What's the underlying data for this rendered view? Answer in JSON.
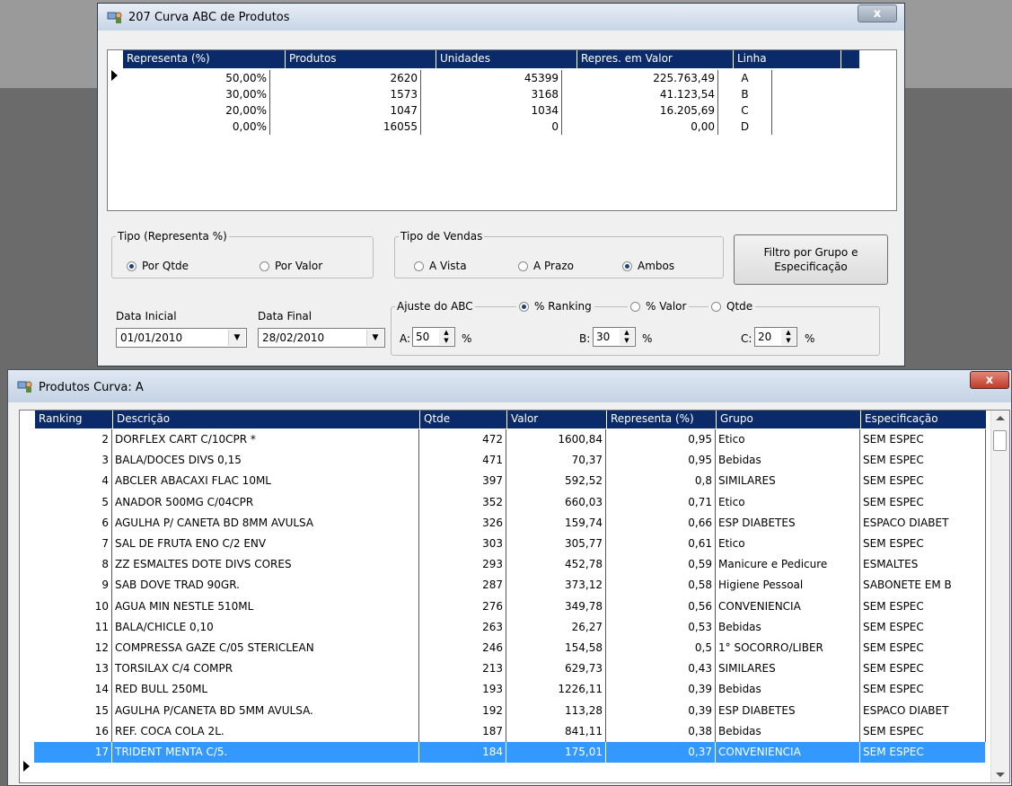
{
  "abc_window": {
    "title": "207 Curva ABC de Produtos",
    "close": "x",
    "columns": [
      "Representa (%)",
      "Produtos",
      "Unidades",
      "Repres. em Valor",
      "Linha"
    ],
    "rows": [
      [
        "50,00%",
        "2620",
        "45399",
        "225.763,49",
        "A"
      ],
      [
        "30,00%",
        "1573",
        "3168",
        "41.123,54",
        "B"
      ],
      [
        "20,00%",
        "1047",
        "1034",
        "16.205,69",
        "C"
      ],
      [
        "0,00%",
        "16055",
        "0",
        "0,00",
        "D"
      ]
    ],
    "tipo_group": {
      "legend": "Tipo (Representa %)",
      "options": [
        {
          "label": "Por Qtde",
          "checked": true
        },
        {
          "label": "Por Valor",
          "checked": false
        }
      ]
    },
    "vendas_group": {
      "legend": "Tipo de Vendas",
      "options": [
        {
          "label": "A Vista",
          "checked": false
        },
        {
          "label": "A Prazo",
          "checked": false
        },
        {
          "label": "Ambos",
          "checked": true
        }
      ]
    },
    "filter_button": "Filtro por Grupo e Especificação",
    "data_inicial": {
      "label": "Data Inicial",
      "value": "01/01/2010"
    },
    "data_final": {
      "label": "Data Final",
      "value": "28/02/2010"
    },
    "ajuste_group": {
      "legend": "Ajuste do ABC",
      "options": [
        {
          "label": "% Ranking",
          "checked": true
        },
        {
          "label": "% Valor",
          "checked": false
        },
        {
          "label": "Qtde",
          "checked": false
        }
      ],
      "a_label": "A:",
      "a_value": "50",
      "b_label": "B:",
      "b_value": "30",
      "c_label": "C:",
      "c_value": "20",
      "unit": "%"
    }
  },
  "curva_window": {
    "title": "Produtos Curva: A",
    "close": "x",
    "columns": [
      "Ranking",
      "Descrição",
      "Qtde",
      "Valor",
      "Representa (%)",
      "Grupo",
      "Especificação"
    ],
    "rows": [
      [
        "2",
        "DORFLEX CART C/10CPR *",
        "472",
        "1600,84",
        "0,95",
        "Etico",
        "SEM ESPEC"
      ],
      [
        "3",
        "BALA/DOCES DIVS 0,15",
        "471",
        "70,37",
        "0,95",
        "Bebidas",
        "SEM ESPEC"
      ],
      [
        "4",
        "ABCLER ABACAXI FLAC 10ML",
        "397",
        "592,52",
        "0,8",
        "SIMILARES",
        "SEM ESPEC"
      ],
      [
        "5",
        "ANADOR 500MG C/04CPR",
        "352",
        "660,03",
        "0,71",
        "Etico",
        "SEM ESPEC"
      ],
      [
        "6",
        "AGULHA P/ CANETA BD 8MM AVULSA",
        "326",
        "159,74",
        "0,66",
        "ESP DIABETES",
        "ESPACO DIABET"
      ],
      [
        "7",
        "SAL DE FRUTA ENO C/2 ENV",
        "303",
        "305,77",
        "0,61",
        "Etico",
        "SEM ESPEC"
      ],
      [
        "8",
        "ZZ ESMALTES DOTE DIVS CORES",
        "293",
        "452,78",
        "0,59",
        "Manicure e Pedicure",
        "ESMALTES"
      ],
      [
        "9",
        "SAB DOVE TRAD 90GR.",
        "287",
        "373,12",
        "0,58",
        "Higiene Pessoal",
        "SABONETE EM B"
      ],
      [
        "10",
        "AGUA MIN NESTLE 510ML",
        "276",
        "349,78",
        "0,56",
        "CONVENIENCIA",
        "SEM ESPEC"
      ],
      [
        "11",
        "BALA/CHICLE 0,10",
        "263",
        "26,27",
        "0,53",
        "Bebidas",
        "SEM ESPEC"
      ],
      [
        "12",
        "COMPRESSA GAZE C/05 STERICLEAN",
        "246",
        "154,58",
        "0,5",
        "1° SOCORRO/LIBER",
        "SEM ESPEC"
      ],
      [
        "13",
        "TORSILAX C/4 COMPR",
        "213",
        "629,73",
        "0,43",
        "SIMILARES",
        "SEM ESPEC"
      ],
      [
        "14",
        "RED BULL 250ML",
        "193",
        "1226,11",
        "0,39",
        "Bebidas",
        "SEM ESPEC"
      ],
      [
        "15",
        "AGULHA P/CANETA BD 5MM AVULSA.",
        "192",
        "113,28",
        "0,39",
        "ESP DIABETES",
        "ESPACO DIABET"
      ],
      [
        "16",
        "REF. COCA COLA 2L.",
        "187",
        "841,11",
        "0,38",
        "Bebidas",
        "SEM ESPEC"
      ],
      [
        "17",
        "TRIDENT MENTA C/5.",
        "184",
        "175,01",
        "0,37",
        "CONVENIENCIA",
        "SEM ESPEC"
      ]
    ],
    "selected_row": 15
  },
  "colors": {
    "header_bg": "#0a2a6a",
    "selection": "#3399ff",
    "close_red": "#c8463a"
  }
}
